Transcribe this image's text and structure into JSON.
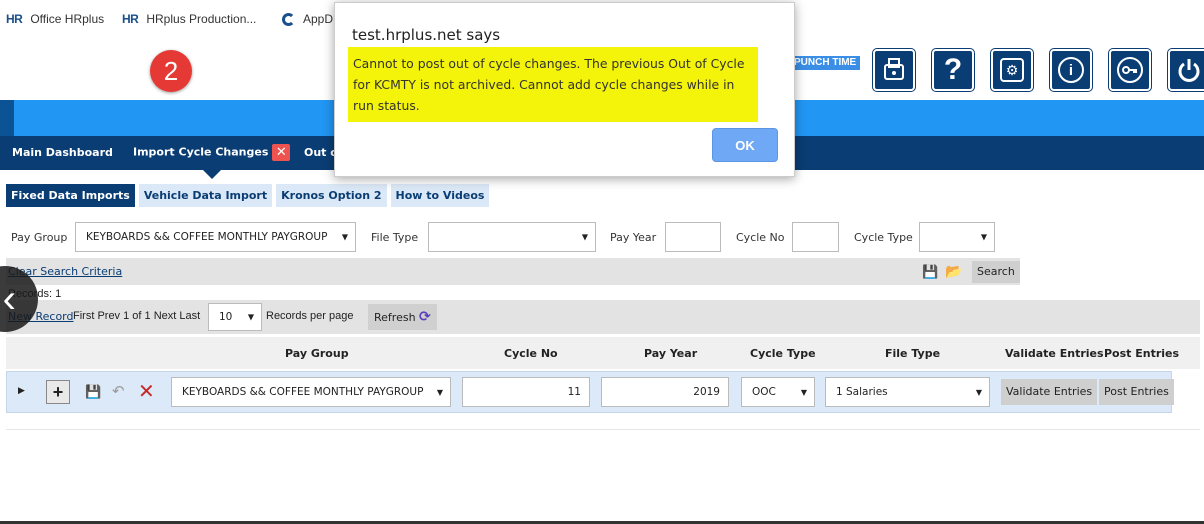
{
  "bookmarks": [
    {
      "logo": "HR",
      "label": "Office HRplus"
    },
    {
      "logo": "HR",
      "label": "HRplus Production..."
    },
    {
      "logo": "",
      "label": "AppD"
    }
  ],
  "step_badge": "2",
  "header": {
    "punch_time": "PUNCH TIME",
    "icons": [
      "payroll-icon",
      "help-icon",
      "settings-icon",
      "info-icon",
      "password-key-icon",
      "power-icon"
    ],
    "help_glyph": "?",
    "info_glyph": "i"
  },
  "nav": {
    "tabs": [
      {
        "label": "Main Dashboard"
      },
      {
        "label": "Import Cycle Changes",
        "closable": true,
        "close_glyph": "✕"
      },
      {
        "label": "Out of"
      }
    ]
  },
  "subtabs": [
    "Fixed Data Imports",
    "Vehicle Data Import",
    "Kronos Option 2",
    "How to Videos"
  ],
  "filters": {
    "pay_group_label": "Pay Group",
    "pay_group_value": "KEYBOARDS && COFFEE MONTHLY PAYGROUP",
    "file_type_label": "File Type",
    "file_type_value": "",
    "pay_year_label": "Pay Year",
    "pay_year_value": "",
    "cycle_no_label": "Cycle No",
    "cycle_no_value": "",
    "cycle_type_label": "Cycle Type",
    "cycle_type_value": ""
  },
  "search": {
    "clear_label": "Clear Search Criteria",
    "search_label": "Search",
    "records_text": "Records:  1"
  },
  "pager": {
    "new_record": "New Record",
    "nav_text": "First Prev 1 of 1 Next Last",
    "per_page_value": "10",
    "per_page_label": "Records per page",
    "refresh_label": "Refresh"
  },
  "grid": {
    "headers": [
      "Pay Group",
      "Cycle No",
      "Pay Year",
      "Cycle Type",
      "File Type",
      "Validate Entries",
      "Post Entries"
    ],
    "row": {
      "pay_group": "KEYBOARDS && COFFEE MONTHLY PAYGROUP",
      "cycle_no": "11",
      "pay_year": "2019",
      "cycle_type": "OOC",
      "file_type": "1 Salaries",
      "validate_label": "Validate Entries",
      "post_label": "Post Entries"
    }
  },
  "dialog": {
    "title": "test.hrplus.net says",
    "message": "Cannot to post out of cycle changes. The previous Out of Cycle for KCMTY is not archived. Cannot add cycle changes while in run status.",
    "ok_label": "OK"
  },
  "colors": {
    "nav_dark": "#0a3d74",
    "accent_blue": "#2196f3",
    "highlight": "#f4f30a",
    "danger": "#e53935"
  }
}
